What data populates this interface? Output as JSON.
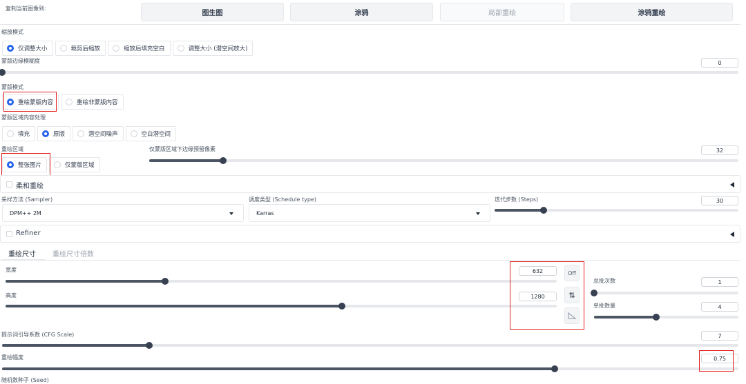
{
  "copy_image_to": {
    "label": "复制当前图像到:",
    "buttons": [
      "图生图",
      "涂鸦",
      "局部重绘",
      "涂鸦重绘"
    ]
  },
  "resize_mode": {
    "label": "缩放模式",
    "options": [
      "仅调整大小",
      "裁剪后缩放",
      "缩放后填充空白",
      "调整大小 (潜空间放大)"
    ],
    "selected": 0
  },
  "mask_blur": {
    "label": "蒙版边缘模糊度",
    "value": "0",
    "fraction": 0.0
  },
  "mask_mode": {
    "label": "蒙版模式",
    "options": [
      "重绘蒙版内容",
      "重绘非蒙版内容"
    ],
    "selected": 0
  },
  "masked_content": {
    "label": "蒙版区域内容处理",
    "options": [
      "填充",
      "原版",
      "潜空间噪声",
      "空白潜空间"
    ],
    "selected": 1
  },
  "inpaint_area": {
    "label": "重绘区域",
    "options": [
      "整张图片",
      "仅蒙版区域"
    ],
    "selected": 0
  },
  "only_masked_padding": {
    "label": "仅蒙版区域下边缘预留像素",
    "value": "32",
    "fraction": 0.125
  },
  "soft_inpainting": {
    "label": "柔和重绘"
  },
  "sampler": {
    "label": "采样方法 (Sampler)",
    "value": "DPM++ 2M"
  },
  "schedule_type": {
    "label": "调度类型 (Schedule type)",
    "value": "Karras"
  },
  "steps": {
    "label": "迭代步数 (Steps)",
    "value": "30",
    "fraction": 0.2
  },
  "refiner": {
    "label": "Refiner"
  },
  "size_tabs": {
    "tabs": [
      "重绘尺寸",
      "重绘尺寸倍数"
    ],
    "active": 0
  },
  "width": {
    "label": "宽度",
    "value": "632",
    "fraction": 0.29
  },
  "height": {
    "label": "高度",
    "value": "1280",
    "fraction": 0.61
  },
  "size_buttons": {
    "off": "Off",
    "swap": "⇅"
  },
  "batch_count": {
    "label": "总批次数",
    "value": "1",
    "fraction": 0.0
  },
  "batch_size": {
    "label": "单批数量",
    "value": "4",
    "fraction": 0.43
  },
  "cfg_scale": {
    "label": "提示词引导系数 (CFG Scale)",
    "value": "7",
    "fraction": 0.2
  },
  "denoising": {
    "label": "重绘幅度",
    "value": "0.75",
    "fraction": 0.75
  },
  "seed": {
    "label": "随机数种子 (Seed)"
  },
  "colors": {
    "accent": "#2563eb",
    "highlight": "#e11d1d",
    "slider": "#4b5563"
  }
}
